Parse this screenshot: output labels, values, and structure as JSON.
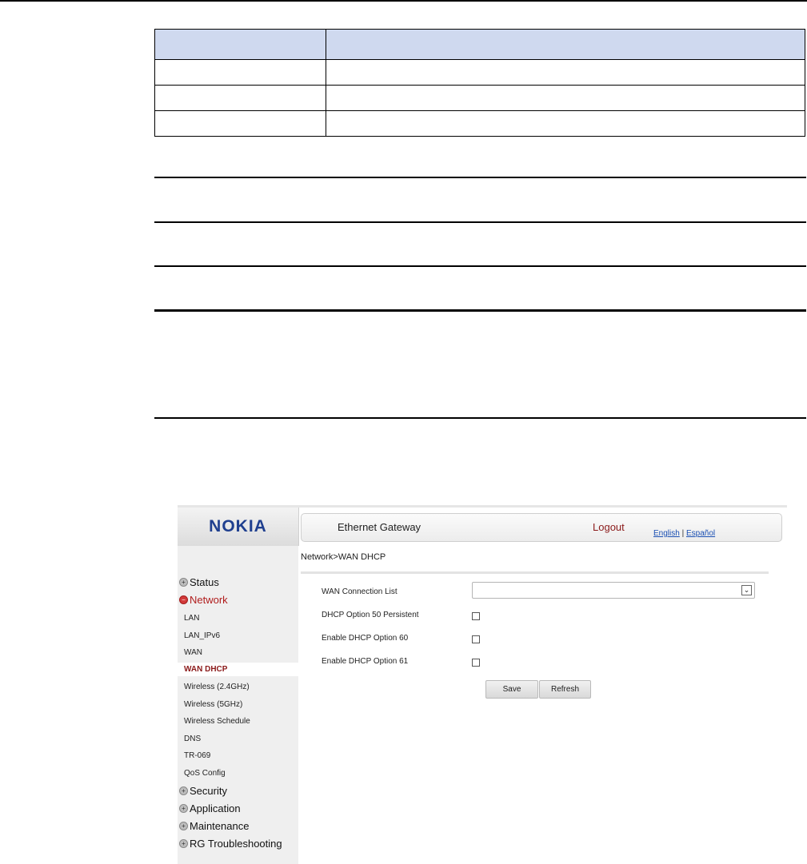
{
  "document": {
    "table": {
      "rows": 3
    },
    "notes": 4
  },
  "screenshot": {
    "logo": "NOKIA",
    "header": {
      "title": "Ethernet Gateway",
      "logout": "Logout",
      "lang_english": "English",
      "lang_separator": "|",
      "lang_espanol": "Español"
    },
    "breadcrumb": "Network>WAN DHCP",
    "sidebar": {
      "status": "Status",
      "network": "Network",
      "network_items": [
        "LAN",
        "LAN_IPv6",
        "WAN",
        "WAN DHCP",
        "Wireless (2.4GHz)",
        "Wireless (5GHz)",
        "Wireless Schedule",
        "DNS",
        "TR-069",
        "QoS Config"
      ],
      "active_item": "WAN DHCP",
      "security": "Security",
      "application": "Application",
      "maintenance": "Maintenance",
      "troubleshooting": "RG Troubleshooting"
    },
    "form": {
      "wan_connection_label": "WAN Connection List",
      "wan_connection_value": "",
      "opt50_label": "DHCP Option 50 Persistent",
      "opt50_checked": false,
      "opt60_label": "Enable DHCP Option 60",
      "opt60_checked": false,
      "opt61_label": "Enable DHCP Option 61",
      "opt61_checked": false,
      "save": "Save",
      "refresh": "Refresh"
    },
    "colors": {
      "logo": "#1f3f8f",
      "active_nav": "#b01c1c",
      "link": "#1a4fb3",
      "table_header": "#cfd9ef"
    }
  }
}
